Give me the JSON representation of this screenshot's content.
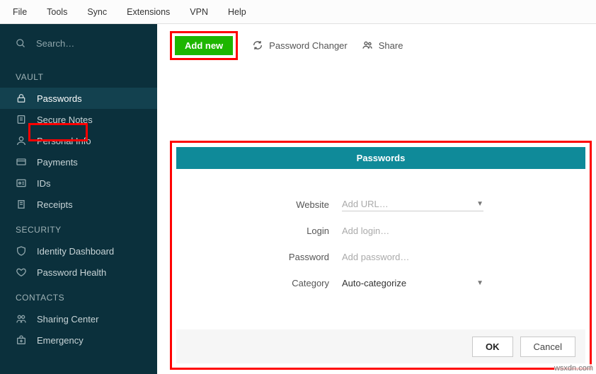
{
  "menubar": {
    "items": [
      "File",
      "Tools",
      "Sync",
      "Extensions",
      "VPN",
      "Help"
    ]
  },
  "search": {
    "placeholder": "Search…"
  },
  "sidebar": {
    "sections": [
      {
        "title": "VAULT",
        "items": [
          {
            "label": "Passwords",
            "icon": "lock-icon",
            "active": true
          },
          {
            "label": "Secure Notes",
            "icon": "note-icon"
          },
          {
            "label": "Personal Info",
            "icon": "person-icon"
          },
          {
            "label": "Payments",
            "icon": "card-icon"
          },
          {
            "label": "IDs",
            "icon": "id-icon"
          },
          {
            "label": "Receipts",
            "icon": "receipt-icon"
          }
        ]
      },
      {
        "title": "SECURITY",
        "items": [
          {
            "label": "Identity Dashboard",
            "icon": "shield-icon"
          },
          {
            "label": "Password Health",
            "icon": "heart-icon"
          }
        ]
      },
      {
        "title": "CONTACTS",
        "items": [
          {
            "label": "Sharing Center",
            "icon": "share-icon"
          },
          {
            "label": "Emergency",
            "icon": "kit-icon"
          }
        ]
      }
    ]
  },
  "toolbar": {
    "add_new_label": "Add new",
    "password_changer_label": "Password Changer",
    "share_label": "Share"
  },
  "panel": {
    "title": "Passwords",
    "fields": {
      "website_label": "Website",
      "website_placeholder": "Add URL…",
      "login_label": "Login",
      "login_placeholder": "Add login…",
      "password_label": "Password",
      "password_placeholder": "Add password…",
      "category_label": "Category",
      "category_value": "Auto-categorize"
    },
    "ok_label": "OK",
    "cancel_label": "Cancel"
  },
  "watermark": "wsxdn.com"
}
